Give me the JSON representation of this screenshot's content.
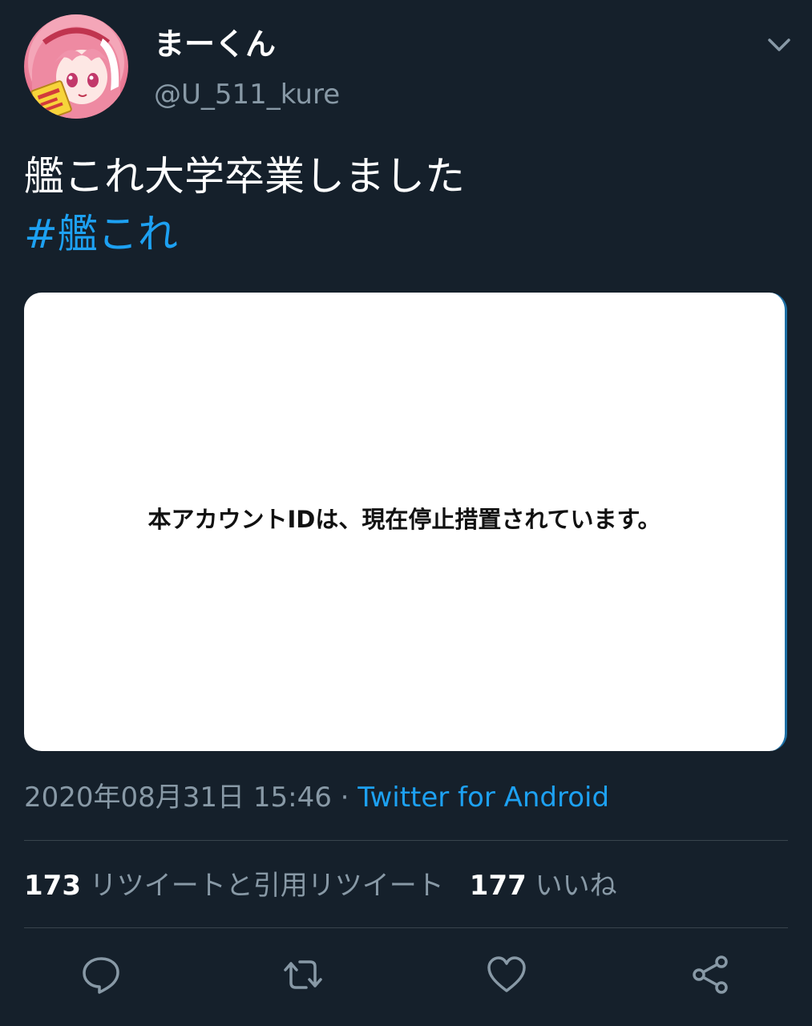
{
  "user": {
    "display_name": "まーくん",
    "handle": "@U_511_kure"
  },
  "tweet": {
    "text": "艦これ大学卒業しました",
    "hashtag": "#艦これ",
    "media_text": "本アカウントIDは、現在停止措置されています。",
    "timestamp": "2020年08月31日 15:46",
    "separator": " · ",
    "source": "Twitter for Android"
  },
  "stats": {
    "retweets_count": "173",
    "retweets_label": "リツイートと引用リツイート",
    "likes_count": "177",
    "likes_label": "いいね"
  },
  "actions": [
    "reply-icon",
    "retweet-icon",
    "like-icon",
    "share-icon"
  ],
  "colors": {
    "background": "#15202b",
    "accent": "#1da1f2",
    "secondary_text": "#8899a6",
    "divider": "#38444d"
  }
}
